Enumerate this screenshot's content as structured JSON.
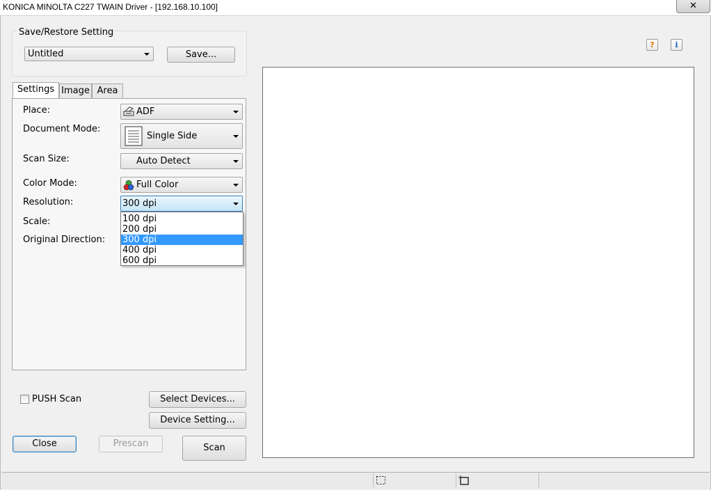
{
  "window": {
    "title": "KONICA MINOLTA C227 TWAIN Driver - [192.168.10.100]"
  },
  "save_restore": {
    "group_label": "Save/Restore Setting",
    "preset_value": "Untitled",
    "save_label": "Save..."
  },
  "tabs": [
    {
      "label": "Settings",
      "active": true
    },
    {
      "label": "Image",
      "active": false
    },
    {
      "label": "Area",
      "active": false
    }
  ],
  "settings": {
    "place_label": "Place:",
    "place_value": "ADF",
    "document_mode_label": "Document Mode:",
    "document_mode_value": "Single Side",
    "scan_size_label": "Scan Size:",
    "scan_size_value": "Auto Detect",
    "color_mode_label": "Color Mode:",
    "color_mode_value": "Full Color",
    "resolution_label": "Resolution:",
    "resolution_value": "300 dpi",
    "scale_label": "Scale:",
    "original_direction_label": "Original Direction:"
  },
  "resolution_options": [
    "100 dpi",
    "200 dpi",
    "300 dpi",
    "400 dpi",
    "600 dpi"
  ],
  "resolution_selected_index": 2,
  "bottom": {
    "push_scan_label": "PUSH Scan",
    "select_devices_label": "Select Devices...",
    "device_setting_label": "Device Setting...",
    "close_label": "Close",
    "prescan_label": "Prescan",
    "scan_label": "Scan"
  },
  "help_icons": {
    "help": "?",
    "info": "i"
  },
  "close_glyph": "✕",
  "colors": {
    "selection": "#3399ff",
    "help_orange": "#e07b00",
    "info_blue": "#1c5fbf"
  }
}
